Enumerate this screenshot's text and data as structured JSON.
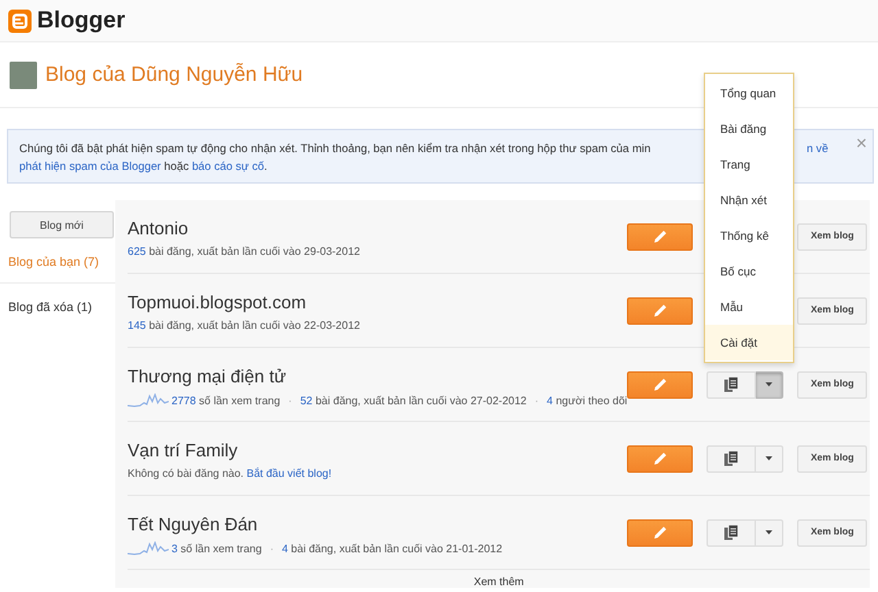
{
  "header": {
    "logo_text": "Blogger"
  },
  "blog_title": "Blog của Dũng Nguyễn Hữu",
  "notice": {
    "line1": "Chúng tôi đã bật phát hiện spam tự động cho nhận xét. Thỉnh thoảng, bạn nên kiểm tra nhận xét trong hộp thư spam của min",
    "line1_tail": "n về",
    "link1": "phát hiện spam của Blogger",
    "middle": " hoặc ",
    "link2": "báo cáo sự cố",
    "end": ".",
    "close": "×"
  },
  "sidebar": {
    "new_blog_button": "Blog mới",
    "items": [
      {
        "label": "Blog của bạn (7)",
        "selected": true
      },
      {
        "label": "Blog đã xóa (1)",
        "selected": false
      }
    ]
  },
  "blogs": [
    {
      "title": "Antonio",
      "sparkline": false,
      "menu_button": false,
      "view_button": "Xem blog",
      "meta": [
        {
          "kind": "count",
          "number": "625",
          "text": " bài đăng, xuất bản lần cuối vào 29-03-2012"
        }
      ]
    },
    {
      "title": "Topmuoi.blogspot.com",
      "sparkline": false,
      "menu_button": false,
      "view_button": "Xem blog",
      "meta": [
        {
          "kind": "count",
          "number": "145",
          "text": " bài đăng, xuất bản lần cuối vào 22-03-2012"
        }
      ]
    },
    {
      "title": "Thương mại điện tử",
      "sparkline": true,
      "menu_button": true,
      "menu_open": true,
      "view_button": "Xem blog",
      "meta": [
        {
          "kind": "count",
          "number": "2778",
          "text": " số lần xem trang"
        },
        {
          "kind": "separator",
          "text": "·"
        },
        {
          "kind": "count",
          "number": "52",
          "text": " bài đăng, xuất bản lần cuối vào 27-02-2012"
        },
        {
          "kind": "separator",
          "text": "·"
        },
        {
          "kind": "count",
          "number": "4",
          "text": " người theo dõi"
        }
      ]
    },
    {
      "title": "Vạn trí Family",
      "sparkline": false,
      "menu_button": true,
      "menu_open": false,
      "view_button": "Xem blog",
      "meta": [
        {
          "kind": "text",
          "text": "Không có bài đăng nào. "
        },
        {
          "kind": "link",
          "text": "Bắt đầu viết blog!"
        }
      ]
    },
    {
      "title": "Tết Nguyên Đán",
      "sparkline": true,
      "menu_button": true,
      "menu_open": false,
      "view_button": "Xem blog",
      "meta": [
        {
          "kind": "count",
          "number": "3",
          "text": " số lần xem trang"
        },
        {
          "kind": "separator",
          "text": "·"
        },
        {
          "kind": "count",
          "number": "4",
          "text": " bài đăng, xuất bản lần cuối vào 21-01-2012"
        }
      ]
    }
  ],
  "more_link": "Xem thêm",
  "dropdown_menu": [
    {
      "label": "Tổng quan",
      "selected": false
    },
    {
      "label": "Bài đăng",
      "selected": false
    },
    {
      "label": "Trang",
      "selected": false
    },
    {
      "label": "Nhận xét",
      "selected": false
    },
    {
      "label": "Thống kê",
      "selected": false
    },
    {
      "label": "Bố cục",
      "selected": false
    },
    {
      "label": "Mẫu",
      "selected": false
    },
    {
      "label": "Cài đặt",
      "selected": true
    }
  ]
}
